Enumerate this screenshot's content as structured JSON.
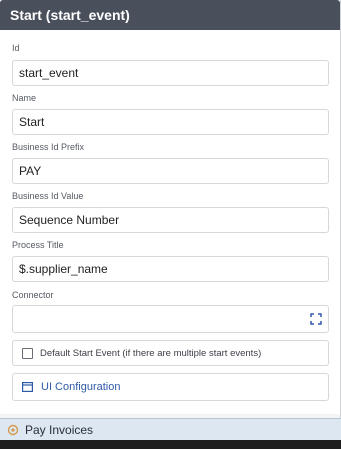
{
  "panel": {
    "title": "Start (start_event)"
  },
  "fields": {
    "id": {
      "label": "Id",
      "value": "start_event"
    },
    "name": {
      "label": "Name",
      "value": "Start"
    },
    "business_id_prefix": {
      "label": "Business Id Prefix",
      "value": "PAY"
    },
    "business_id_value": {
      "label": "Business Id Value",
      "value": "Sequence Number"
    },
    "process_title": {
      "label": "Process Title",
      "value": "$.supplier_name"
    },
    "connector": {
      "label": "Connector",
      "value": ""
    }
  },
  "default_start_event": {
    "label": "Default Start Event (if there are multiple start events)",
    "checked": false
  },
  "ui_configuration": {
    "label": "UI Configuration",
    "icon": "window-icon"
  },
  "bottom_tab": {
    "label": "Pay Invoices",
    "icon": "process-icon"
  },
  "colors": {
    "header_bg": "#4a4f5c",
    "link": "#2f5aa8",
    "tab_bg": "#dde7f1"
  }
}
